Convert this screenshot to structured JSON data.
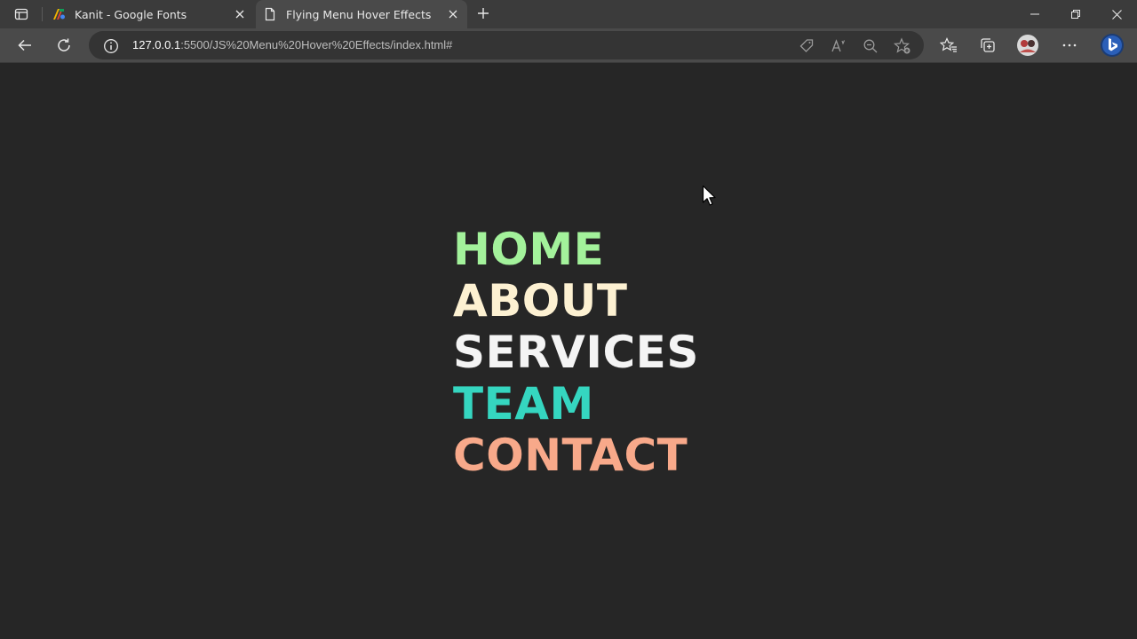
{
  "browser": {
    "tabs": [
      {
        "title": "Kanit - Google Fonts",
        "active": false,
        "favicon": "google-fonts-icon"
      },
      {
        "title": "Flying Menu Hover Effects",
        "active": true,
        "favicon": "page-icon"
      }
    ],
    "address": {
      "host": "127.0.0.1",
      "rest": ":5500/JS%20Menu%20Hover%20Effects/index.html#"
    }
  },
  "menu": {
    "items": [
      {
        "label": "HOME",
        "color": "#a3f29b"
      },
      {
        "label": "ABOUT",
        "color": "#fdf1d2"
      },
      {
        "label": "SERVICES",
        "color": "#f4f4f4"
      },
      {
        "label": "TEAM",
        "color": "#35d6c0"
      },
      {
        "label": "CONTACT",
        "color": "#f8a98a"
      }
    ]
  },
  "colors": {
    "page_bg": "#262626",
    "tabstrip_bg": "#3b3b3b",
    "toolbar_bg": "#4a4a4a"
  }
}
